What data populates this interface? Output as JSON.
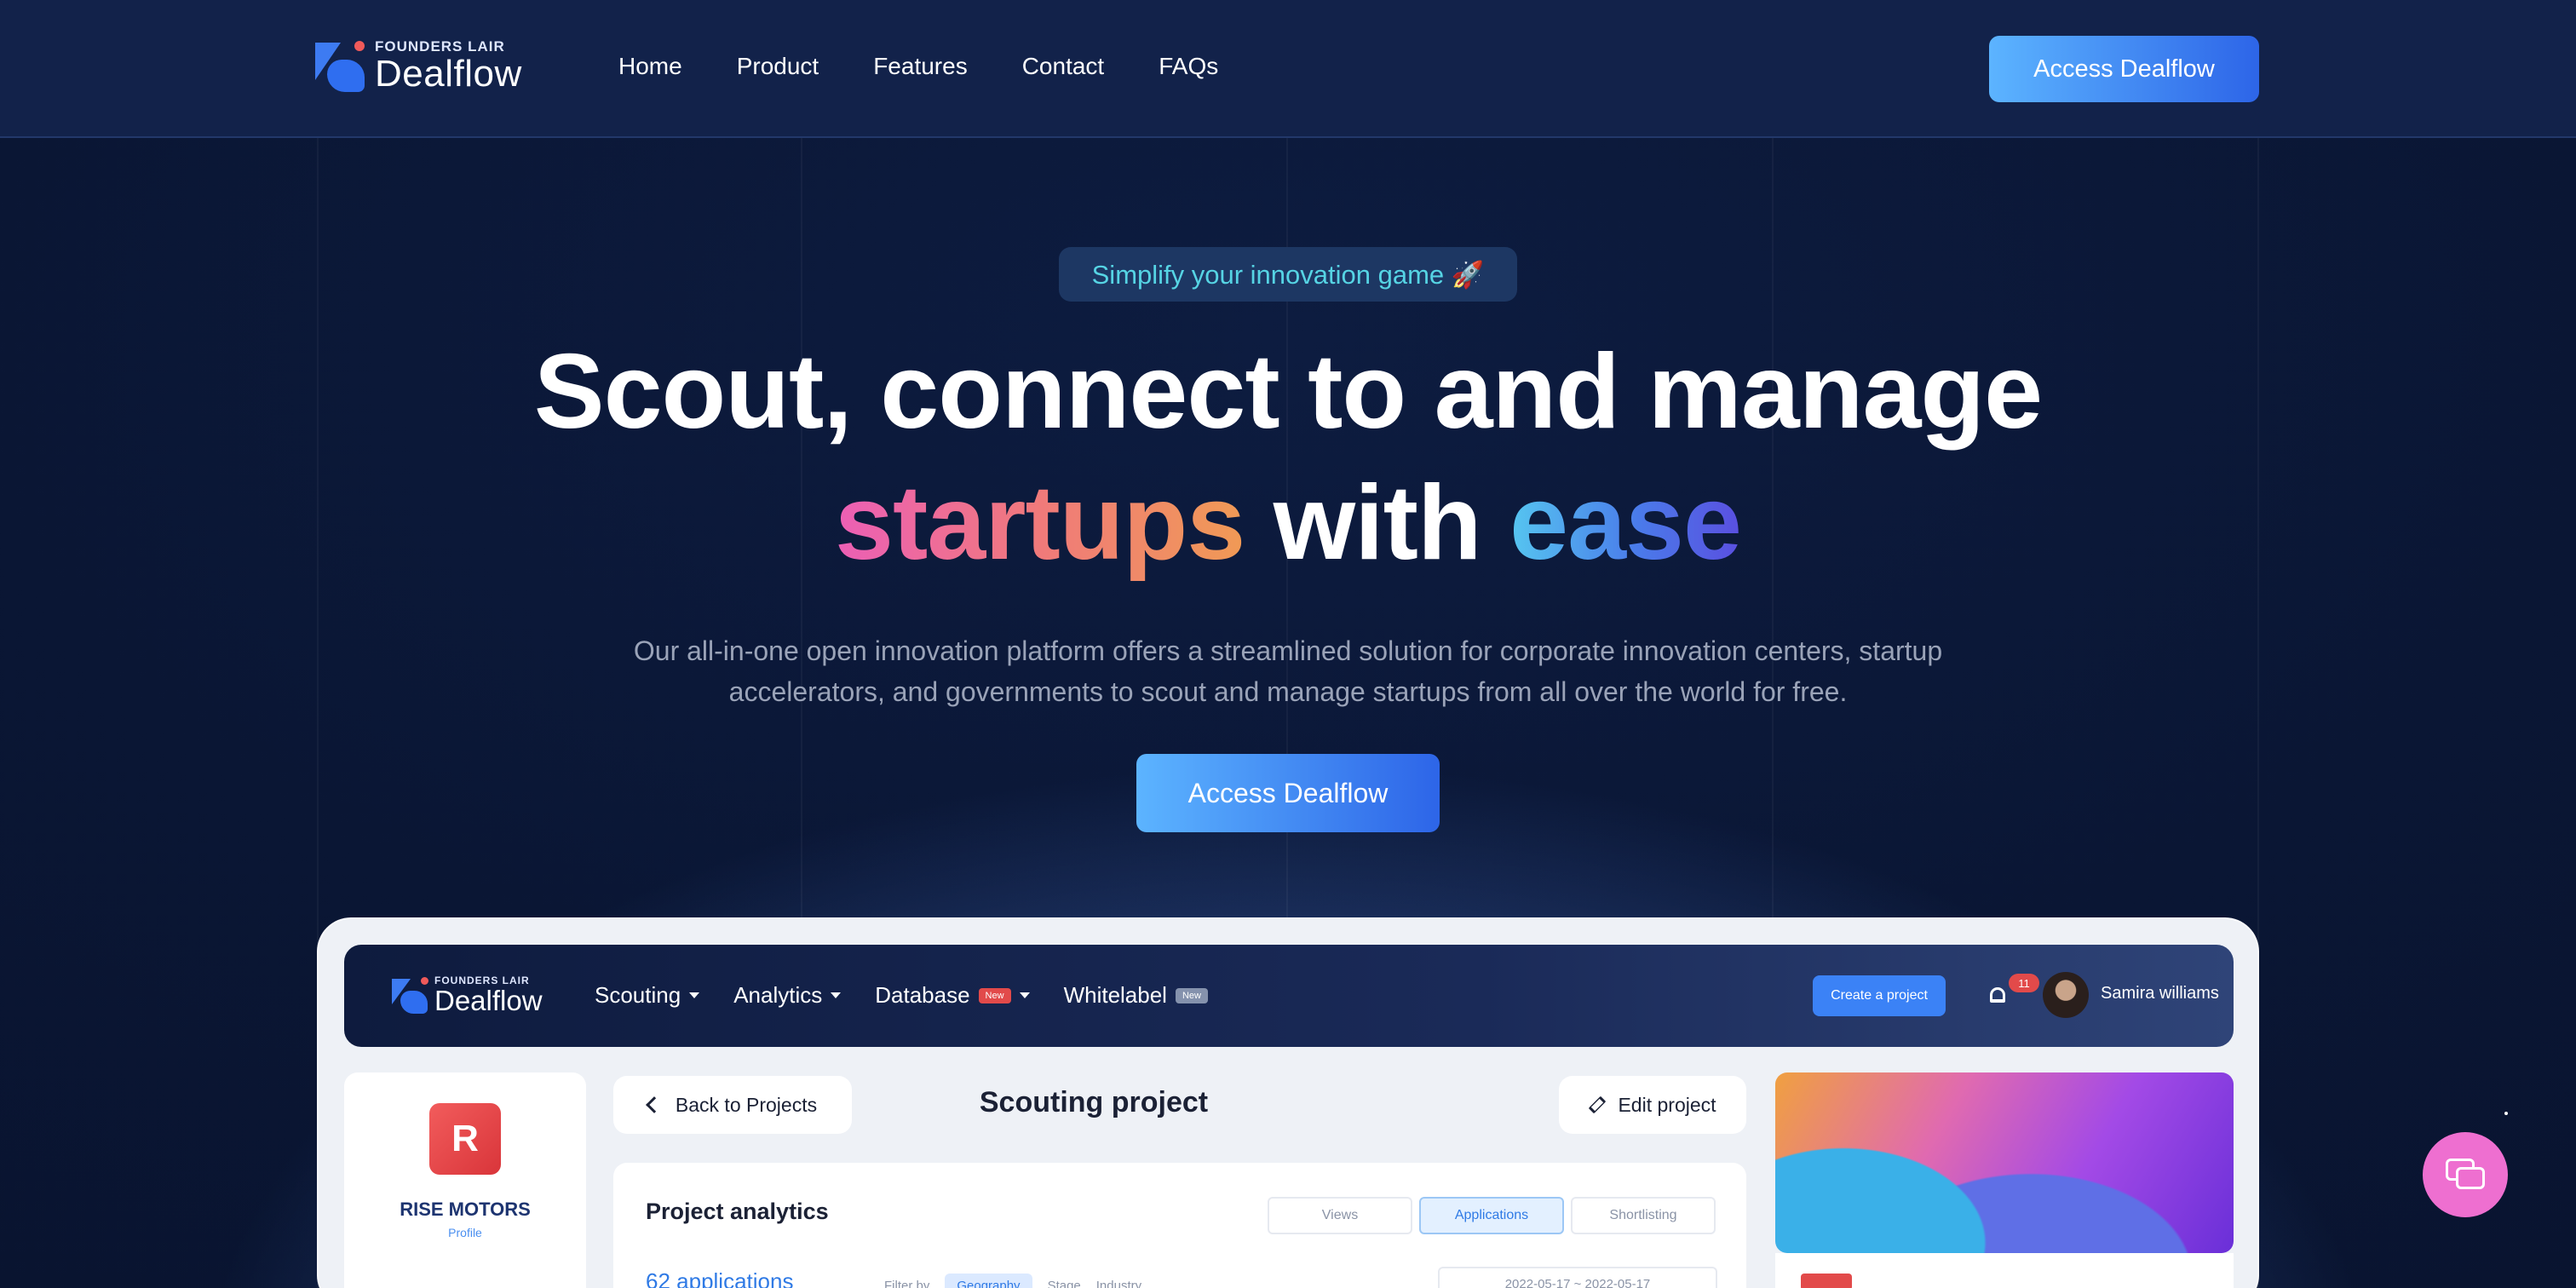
{
  "brand": {
    "small": "FOUNDERS LAIR",
    "name": "Dealflow"
  },
  "nav": {
    "items": [
      "Home",
      "Product",
      "Features",
      "Contact",
      "FAQs"
    ],
    "cta": "Access Dealflow"
  },
  "hero": {
    "pill": "Simplify your innovation game 🚀",
    "line1": "Scout, connect to and manage",
    "word_startups": "startups",
    "word_with": "with",
    "word_ease": "ease",
    "subtitle": "Our all-in-one open innovation platform offers a streamlined solution for corporate innovation centers, startup accelerators, and governments to scout and manage startups from all over the world for free.",
    "cta": "Access Dealflow"
  },
  "preview": {
    "brand": {
      "small": "FOUNDERS LAIR",
      "name": "Dealflow"
    },
    "menu": [
      "Scouting",
      "Analytics",
      "Database",
      "Whitelabel"
    ],
    "badge_new": "New",
    "create_btn": "Create a project",
    "notif_count": "11",
    "user": "Samira williams",
    "company": {
      "name": "RISE MOTORS",
      "profile": "Profile"
    },
    "back": "Back to Projects",
    "title": "Scouting project",
    "edit": "Edit project",
    "analytics": {
      "title": "Project analytics",
      "tabs": [
        "Views",
        "Applications",
        "Shortlisting"
      ],
      "applications": "62 applications",
      "filter_label": "Filter by",
      "filters": [
        "Geography",
        "Stage",
        "Industry"
      ],
      "date": "2022-05-17 ~ 2022-05-17"
    }
  },
  "colors": {
    "accent": "#2d65e8",
    "pill_text": "#56d4e4",
    "chat": "#ee6fd0"
  }
}
